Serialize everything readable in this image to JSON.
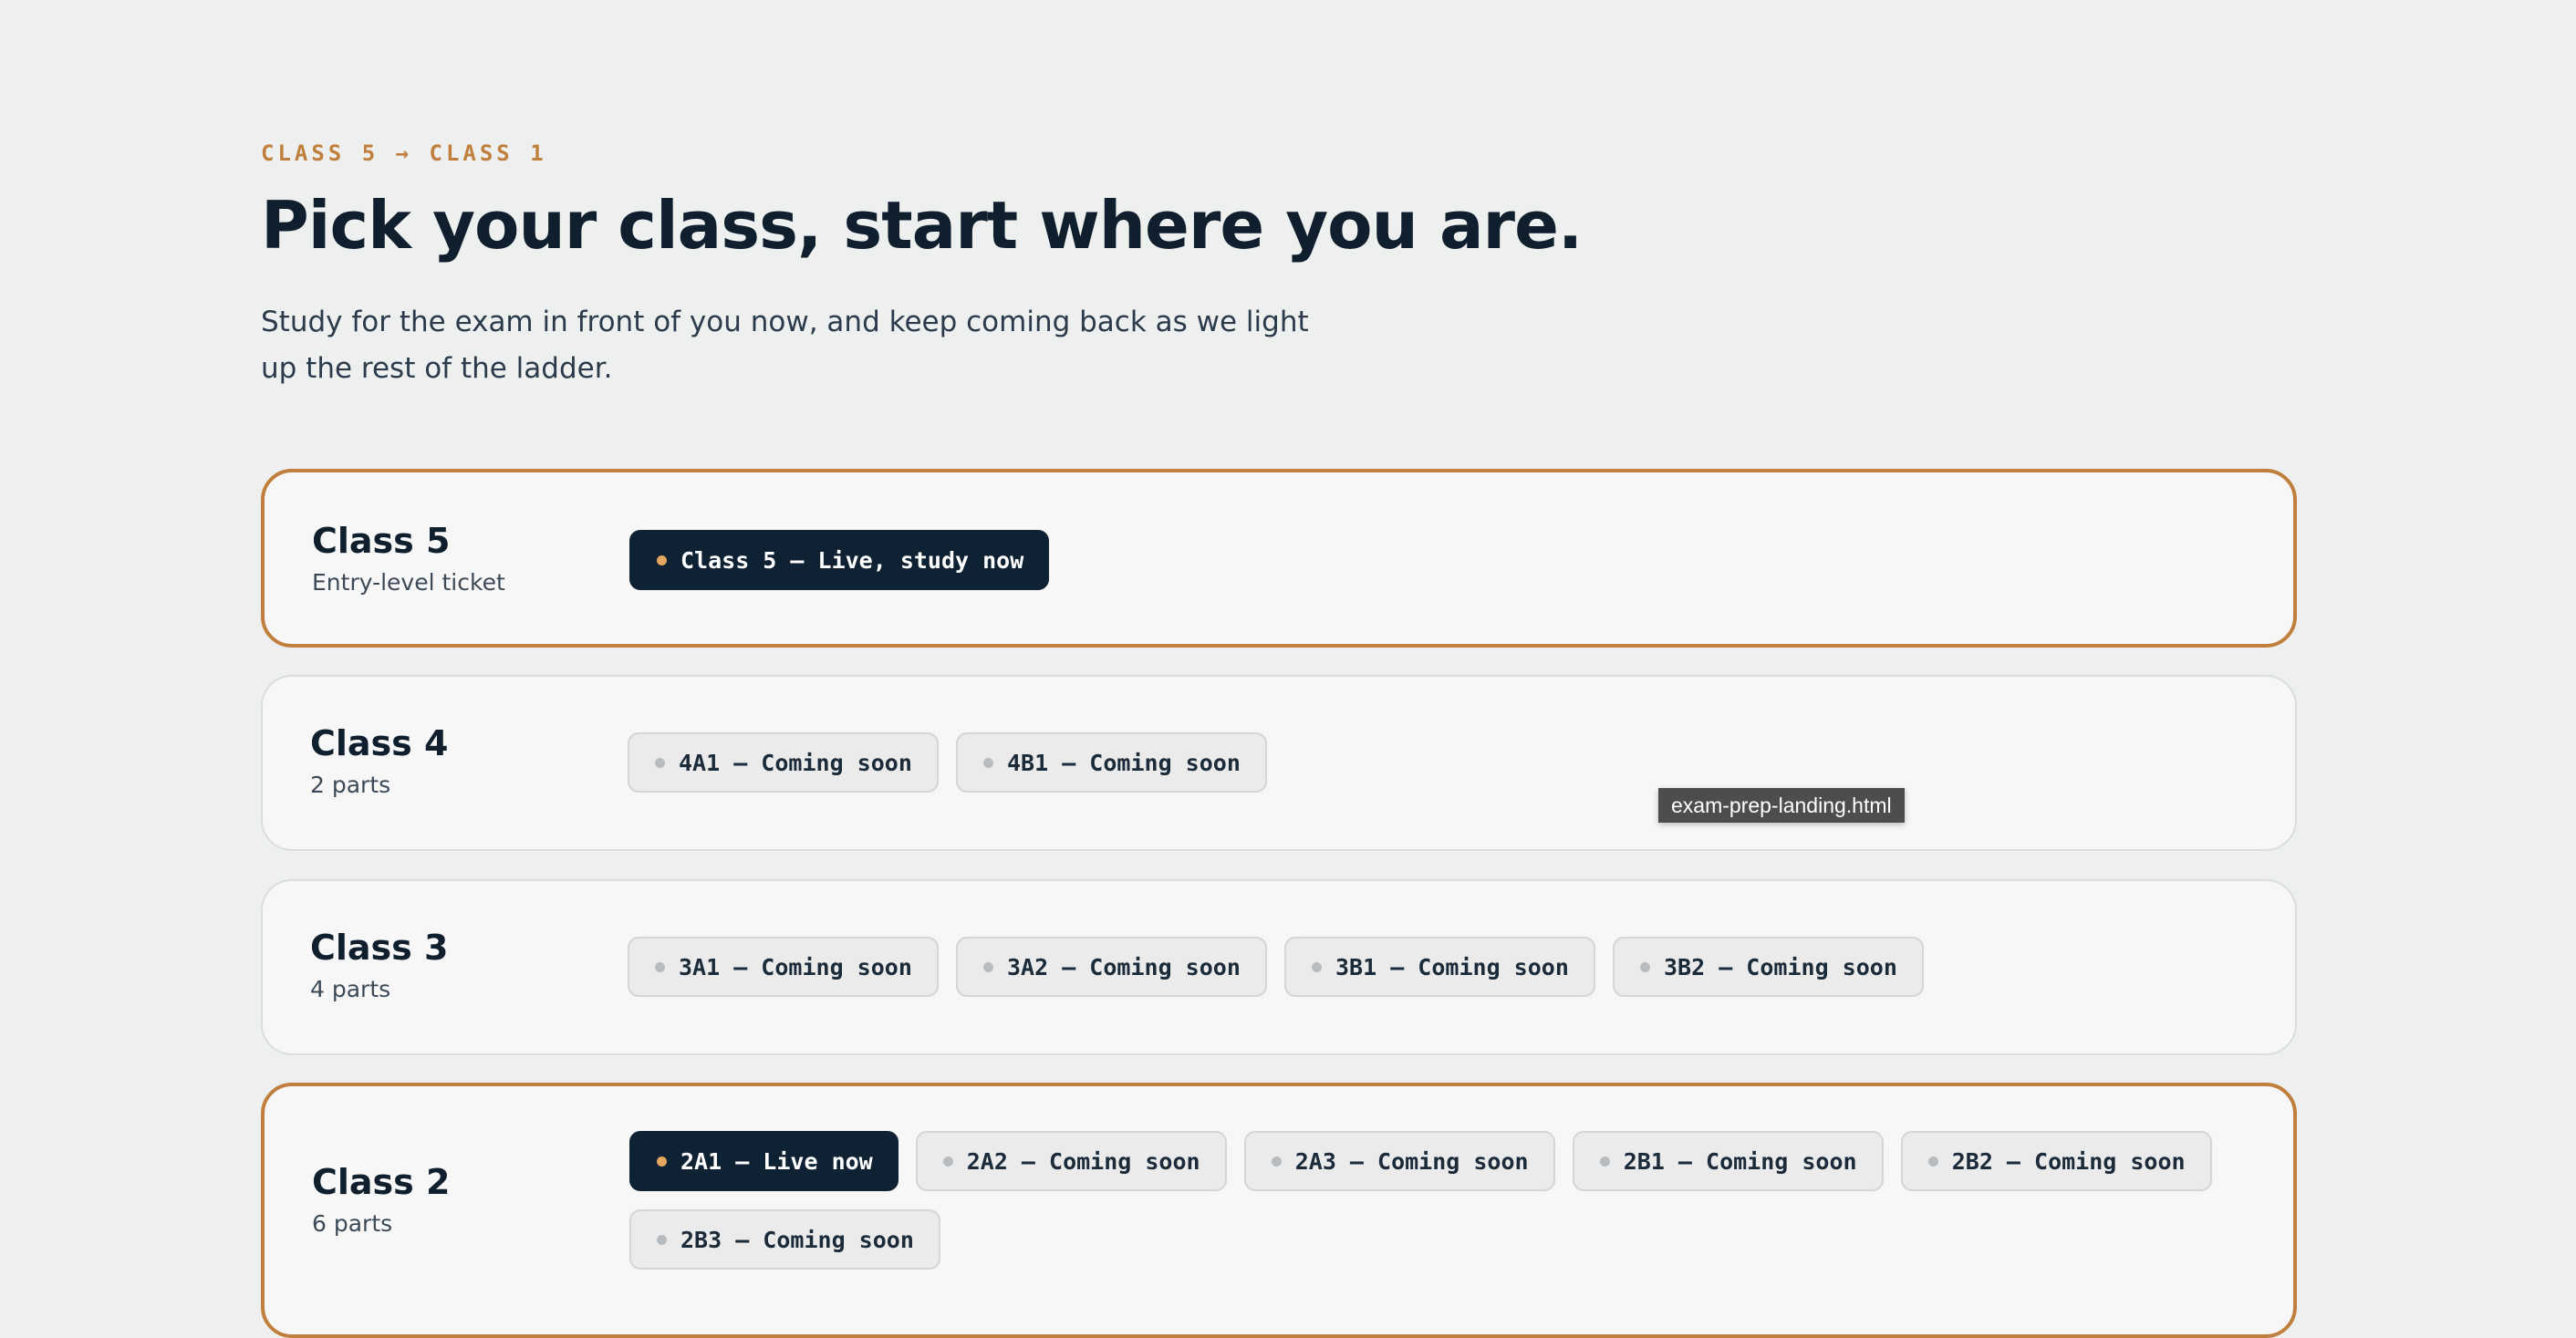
{
  "header": {
    "eyebrow": "CLASS 5 → CLASS 1",
    "title": "Pick your class, start where you are.",
    "subtitle": "Study for the exam in front of you now, and keep coming back as we light up the rest of the ladder."
  },
  "classes": [
    {
      "name": "Class 5",
      "sub": "Entry-level ticket",
      "active": true,
      "chips": [
        {
          "label": "Class 5 — Live, study now",
          "status": "live"
        }
      ]
    },
    {
      "name": "Class 4",
      "sub": "2 parts",
      "active": false,
      "chips": [
        {
          "label": "4A1 — Coming soon",
          "status": "soon"
        },
        {
          "label": "4B1 — Coming soon",
          "status": "soon"
        }
      ]
    },
    {
      "name": "Class 3",
      "sub": "4 parts",
      "active": false,
      "chips": [
        {
          "label": "3A1 — Coming soon",
          "status": "soon"
        },
        {
          "label": "3A2 — Coming soon",
          "status": "soon"
        },
        {
          "label": "3B1 — Coming soon",
          "status": "soon"
        },
        {
          "label": "3B2 — Coming soon",
          "status": "soon"
        }
      ]
    },
    {
      "name": "Class 2",
      "sub": "6 parts",
      "active": true,
      "chips": [
        {
          "label": "2A1 — Live now",
          "status": "live"
        },
        {
          "label": "2A2 — Coming soon",
          "status": "soon"
        },
        {
          "label": "2A3 — Coming soon",
          "status": "soon"
        },
        {
          "label": "2B1 — Coming soon",
          "status": "soon"
        },
        {
          "label": "2B2 — Coming soon",
          "status": "soon"
        },
        {
          "label": "2B3 — Coming soon",
          "status": "soon"
        }
      ]
    }
  ],
  "tooltip": {
    "text": "exam-prep-landing.html"
  },
  "colors": {
    "accent": "#c07f3c",
    "navy": "#0f2233",
    "background": "#eef0ef",
    "card": "#f7f7f7",
    "live_dot": "#e4a55e",
    "soon_dot": "#b7bcc1"
  }
}
